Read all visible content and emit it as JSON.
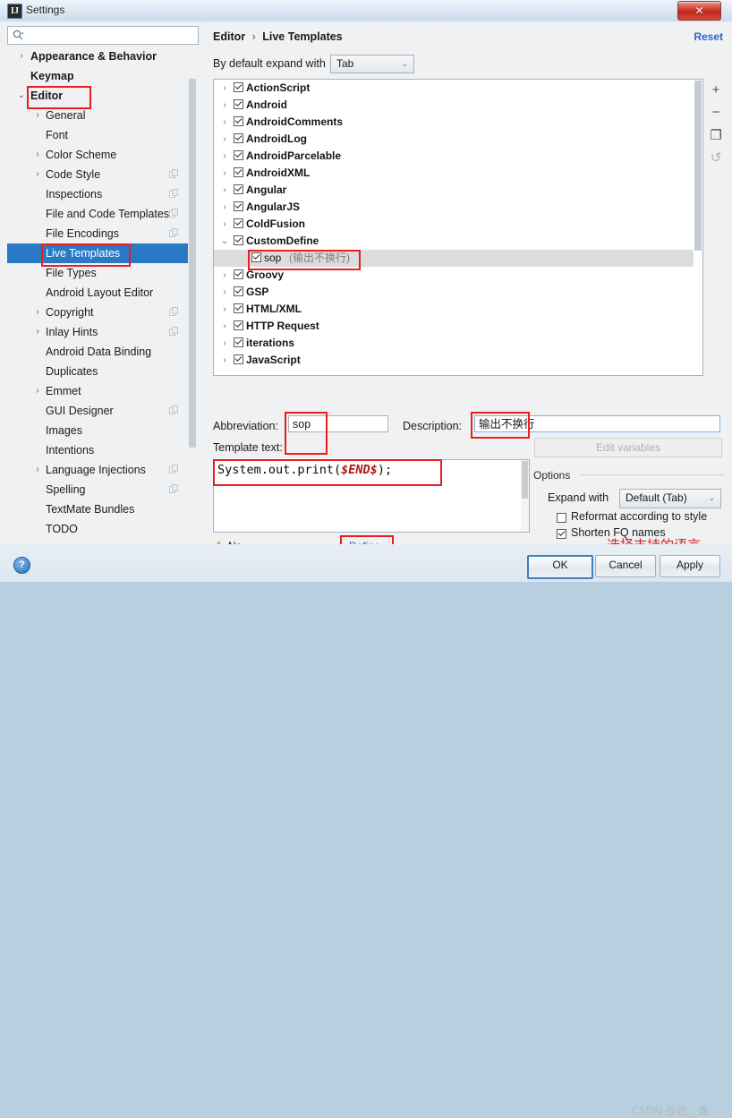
{
  "window": {
    "title": "Settings",
    "app_icon": "idea-icon",
    "close_label": "✕"
  },
  "sidebar": {
    "search": {
      "value": "",
      "placeholder": ""
    },
    "items": [
      {
        "label": "Appearance & Behavior",
        "arrow": "›",
        "level": 0,
        "copy": false,
        "selected": false
      },
      {
        "label": "Keymap",
        "arrow": "",
        "level": 0,
        "copy": false,
        "selected": false
      },
      {
        "label": "Editor",
        "arrow": "⌄",
        "level": 0,
        "copy": false,
        "selected": false,
        "highlight_box": true
      },
      {
        "label": "General",
        "arrow": "›",
        "level": 1,
        "copy": false,
        "selected": false
      },
      {
        "label": "Font",
        "arrow": "",
        "level": 1,
        "copy": false,
        "selected": false
      },
      {
        "label": "Color Scheme",
        "arrow": "›",
        "level": 1,
        "copy": false,
        "selected": false
      },
      {
        "label": "Code Style",
        "arrow": "›",
        "level": 1,
        "copy": true,
        "selected": false
      },
      {
        "label": "Inspections",
        "arrow": "",
        "level": 1,
        "copy": true,
        "selected": false
      },
      {
        "label": "File and Code Templates",
        "arrow": "",
        "level": 1,
        "copy": true,
        "selected": false
      },
      {
        "label": "File Encodings",
        "arrow": "",
        "level": 1,
        "copy": true,
        "selected": false
      },
      {
        "label": "Live Templates",
        "arrow": "",
        "level": 1,
        "copy": false,
        "selected": true,
        "highlight_box": true
      },
      {
        "label": "File Types",
        "arrow": "",
        "level": 1,
        "copy": false,
        "selected": false
      },
      {
        "label": "Android Layout Editor",
        "arrow": "",
        "level": 1,
        "copy": false,
        "selected": false
      },
      {
        "label": "Copyright",
        "arrow": "›",
        "level": 1,
        "copy": true,
        "selected": false
      },
      {
        "label": "Inlay Hints",
        "arrow": "›",
        "level": 1,
        "copy": true,
        "selected": false
      },
      {
        "label": "Android Data Binding",
        "arrow": "",
        "level": 1,
        "copy": false,
        "selected": false
      },
      {
        "label": "Duplicates",
        "arrow": "",
        "level": 1,
        "copy": false,
        "selected": false
      },
      {
        "label": "Emmet",
        "arrow": "›",
        "level": 1,
        "copy": false,
        "selected": false
      },
      {
        "label": "GUI Designer",
        "arrow": "",
        "level": 1,
        "copy": true,
        "selected": false
      },
      {
        "label": "Images",
        "arrow": "",
        "level": 1,
        "copy": false,
        "selected": false
      },
      {
        "label": "Intentions",
        "arrow": "",
        "level": 1,
        "copy": false,
        "selected": false
      },
      {
        "label": "Language Injections",
        "arrow": "›",
        "level": 1,
        "copy": true,
        "selected": false
      },
      {
        "label": "Spelling",
        "arrow": "",
        "level": 1,
        "copy": true,
        "selected": false
      },
      {
        "label": "TextMate Bundles",
        "arrow": "",
        "level": 1,
        "copy": false,
        "selected": false
      },
      {
        "label": "TODO",
        "arrow": "",
        "level": 1,
        "copy": false,
        "selected": false
      }
    ]
  },
  "main": {
    "breadcrumb": {
      "root": "Editor",
      "separator": "›",
      "leaf": "Live Templates"
    },
    "reset_label": "Reset",
    "expand_with": {
      "label": "By default expand with",
      "value": "Tab",
      "arrow": "⌄"
    },
    "templates": [
      {
        "label": "ActionScript",
        "arrow": "›",
        "checked": true,
        "level": 1
      },
      {
        "label": "Android",
        "arrow": "›",
        "checked": true,
        "level": 1
      },
      {
        "label": "AndroidComments",
        "arrow": "›",
        "checked": true,
        "level": 1
      },
      {
        "label": "AndroidLog",
        "arrow": "›",
        "checked": true,
        "level": 1
      },
      {
        "label": "AndroidParcelable",
        "arrow": "›",
        "checked": true,
        "level": 1
      },
      {
        "label": "AndroidXML",
        "arrow": "›",
        "checked": true,
        "level": 1
      },
      {
        "label": "Angular",
        "arrow": "›",
        "checked": true,
        "level": 1
      },
      {
        "label": "AngularJS",
        "arrow": "›",
        "checked": true,
        "level": 1
      },
      {
        "label": "ColdFusion",
        "arrow": "›",
        "checked": true,
        "level": 1
      },
      {
        "label": "CustomDefine",
        "arrow": "⌄",
        "checked": true,
        "level": 1
      },
      {
        "label": "sop",
        "desc": "(输出不换行)",
        "arrow": "",
        "checked": true,
        "level": 2,
        "selected": true,
        "highlight_box": true
      },
      {
        "label": "Groovy",
        "arrow": "›",
        "checked": true,
        "level": 1
      },
      {
        "label": "GSP",
        "arrow": "›",
        "checked": true,
        "level": 1
      },
      {
        "label": "HTML/XML",
        "arrow": "›",
        "checked": true,
        "level": 1
      },
      {
        "label": "HTTP Request",
        "arrow": "›",
        "checked": true,
        "level": 1
      },
      {
        "label": "iterations",
        "arrow": "›",
        "checked": true,
        "level": 1
      },
      {
        "label": "JavaScript",
        "arrow": "›",
        "checked": true,
        "level": 1
      }
    ],
    "toolbar": [
      {
        "name": "add-template-button",
        "glyph": "+",
        "enabled": true
      },
      {
        "name": "remove-template-button",
        "glyph": "−",
        "enabled": true
      },
      {
        "name": "duplicate-template-button",
        "glyph": "❐",
        "enabled": true
      },
      {
        "name": "restore-defaults-button",
        "glyph": "↺",
        "enabled": false
      }
    ],
    "abbreviation": {
      "label": "Abbreviation:",
      "value": "sop"
    },
    "description": {
      "label": "Description:",
      "value": "输出不换行"
    },
    "template_text": {
      "label": "Template text:",
      "prefix": "System.out.print(",
      "variable": "$END$",
      "suffix": ");"
    },
    "edit_variables_label": "Edit variables",
    "context": {
      "warning_glyph": "⚠",
      "text": "No applicable contexts",
      "define_label": "Define",
      "define_arrow": "⌄"
    },
    "annotation_note": "选择支持的语言",
    "options": {
      "title": "Options",
      "expand_with": {
        "label": "Expand with",
        "value": "Default (Tab)",
        "arrow": "⌄"
      },
      "checkboxes": [
        {
          "label": "Reformat according to style",
          "checked": false
        },
        {
          "label": "Shorten FQ names",
          "checked": true
        }
      ]
    }
  },
  "footer": {
    "help_glyph": "?",
    "ok_label": "OK",
    "cancel_label": "Cancel",
    "apply_label": "Apply",
    "watermark": "CSDN @姐__鑫"
  }
}
